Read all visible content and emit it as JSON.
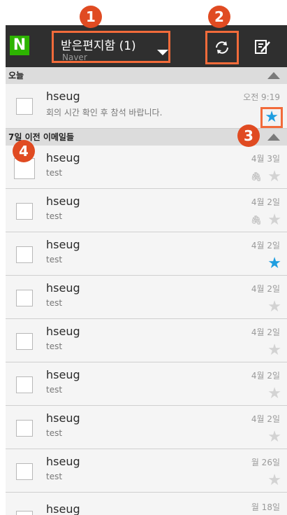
{
  "header": {
    "logo_letter": "N",
    "mailbox_title": "받은편지함 (1)",
    "account": "Naver"
  },
  "sections": [
    {
      "label": "오늘"
    },
    {
      "label": "7일 이전 이메일들"
    }
  ],
  "today_emails": [
    {
      "sender": "hseug",
      "subject": "회의 시간 확인 후 참석 바랍니다.",
      "date": "오전 9:19",
      "starred": true,
      "attachment": false
    }
  ],
  "older_emails": [
    {
      "sender": "hseug",
      "subject": "test",
      "date": "4월 3일",
      "starred": false,
      "attachment": true
    },
    {
      "sender": "hseug",
      "subject": "test",
      "date": "4월 2일",
      "starred": false,
      "attachment": true
    },
    {
      "sender": "hseug",
      "subject": "test",
      "date": "4월 2일",
      "starred": true,
      "attachment": false
    },
    {
      "sender": "hseug",
      "subject": "test",
      "date": "4월 2일",
      "starred": false,
      "attachment": false
    },
    {
      "sender": "hseug",
      "subject": "test",
      "date": "4월 2일",
      "starred": false,
      "attachment": false
    },
    {
      "sender": "hseug",
      "subject": "test",
      "date": "4월 2일",
      "starred": false,
      "attachment": false
    },
    {
      "sender": "hseug",
      "subject": "test",
      "date": "4월 2일",
      "starred": false,
      "attachment": false
    },
    {
      "sender": "hseug",
      "subject": "test",
      "date": "월 26일",
      "starred": false,
      "attachment": false
    },
    {
      "sender": "hseug",
      "subject": "",
      "date": "월 18일",
      "starred": false,
      "attachment": false
    }
  ],
  "callouts": [
    "1",
    "2",
    "3",
    "4"
  ],
  "colors": {
    "actionbar": "#2f2f2f",
    "logo": "#2db400",
    "star_on": "#1e9ee0",
    "callout": "#e04b22",
    "highlight": "#f26b3a"
  },
  "icons": {
    "refresh": "refresh-icon",
    "compose": "compose-icon",
    "star": "star-icon",
    "attachment": "paperclip-icon",
    "dropdown": "caret-down-icon"
  }
}
